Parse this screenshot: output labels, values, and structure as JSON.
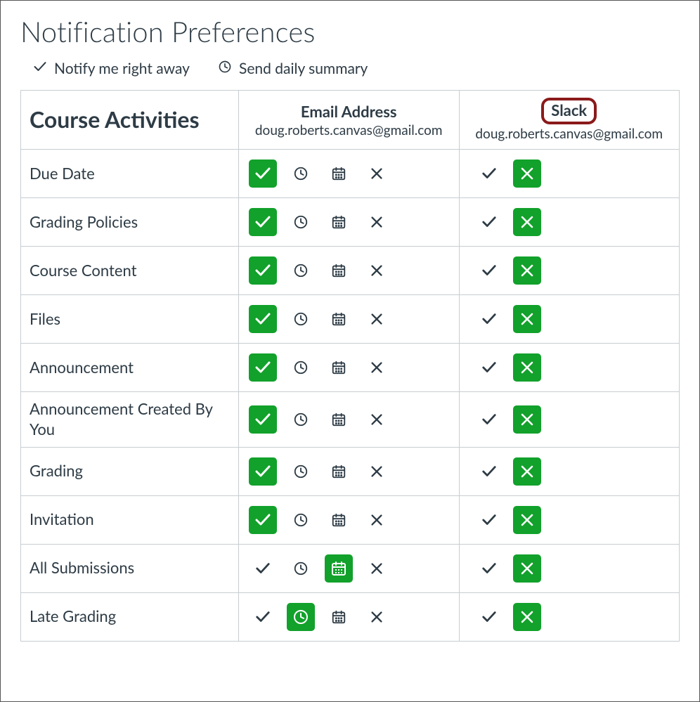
{
  "title": "Notification Preferences",
  "legend": {
    "immediate": "Notify me right away",
    "daily": "Send daily summary"
  },
  "category_header": "Course Activities",
  "channels": [
    {
      "name": "Email Address",
      "address": "doug.roberts.canvas@gmail.com",
      "highlight": false,
      "options": [
        "immediate",
        "daily",
        "weekly",
        "never"
      ]
    },
    {
      "name": "Slack",
      "address": "doug.roberts.canvas@gmail.com",
      "highlight": true,
      "options": [
        "immediate",
        "never"
      ]
    }
  ],
  "activities": [
    {
      "label": "Due Date",
      "selections": [
        "immediate",
        "never"
      ]
    },
    {
      "label": "Grading Policies",
      "selections": [
        "immediate",
        "never"
      ]
    },
    {
      "label": "Course Content",
      "selections": [
        "immediate",
        "never"
      ]
    },
    {
      "label": "Files",
      "selections": [
        "immediate",
        "never"
      ]
    },
    {
      "label": "Announcement",
      "selections": [
        "immediate",
        "never"
      ]
    },
    {
      "label": "Announcement Created By You",
      "selections": [
        "immediate",
        "never"
      ]
    },
    {
      "label": "Grading",
      "selections": [
        "immediate",
        "never"
      ]
    },
    {
      "label": "Invitation",
      "selections": [
        "immediate",
        "never"
      ]
    },
    {
      "label": "All Submissions",
      "selections": [
        "weekly",
        "never"
      ]
    },
    {
      "label": "Late Grading",
      "selections": [
        "daily",
        "never"
      ]
    }
  ],
  "option_labels": {
    "immediate": "Notify immediately",
    "daily": "Daily summary",
    "weekly": "Weekly summary",
    "never": "Never"
  }
}
